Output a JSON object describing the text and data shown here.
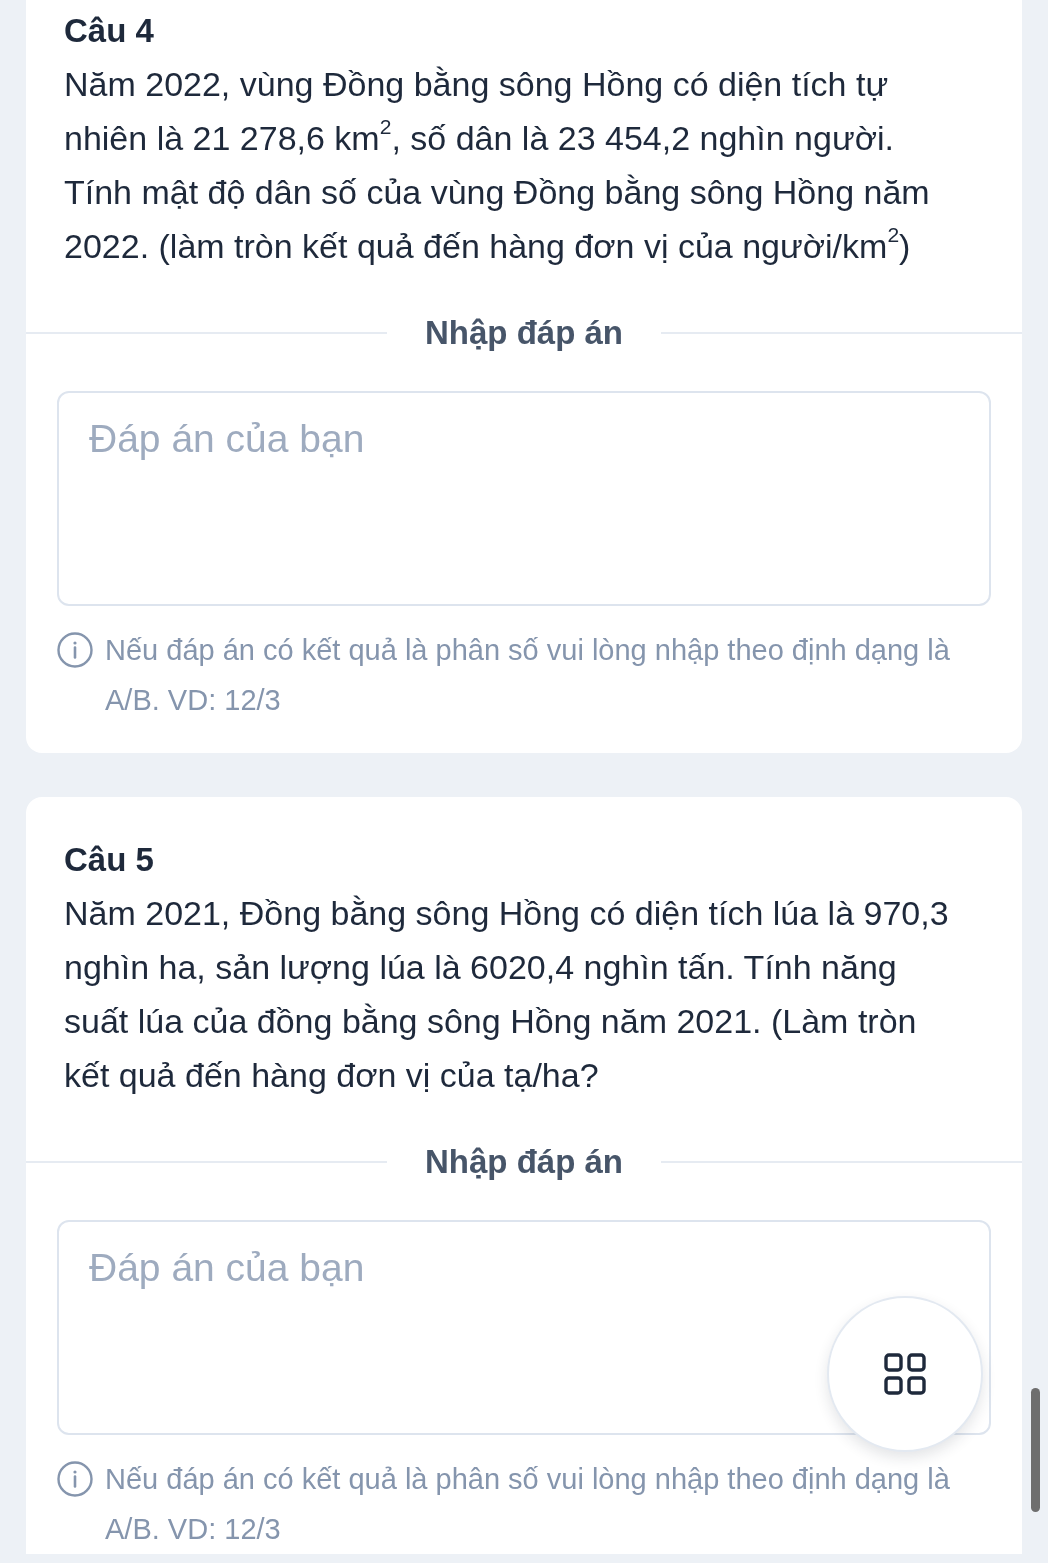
{
  "questions": [
    {
      "title": "Câu 4",
      "text": "Năm 2022, vùng Đồng bằng sông Hồng có diện tích tự nhiên là 21 278,6 km$^{2}$, số dân là 23 454,2 nghìn người. Tính mật độ dân số của vùng Đồng bằng sông Hồng năm 2022. (làm tròn kết quả đến hàng đơn vị của người/km$^{2}$)",
      "answer_heading": "Nhập đáp án",
      "answer_field": {
        "placeholder": "Đáp án của bạn"
      },
      "hint": "Nếu đáp án có kết quả là phân số vui lòng nhập theo định dạng là A/B. VD: 12/3"
    },
    {
      "title": "Câu 5",
      "text": "Năm 2021, Đồng bằng sông Hồng có diện tích lúa là 970,3 nghìn ha, sản lượng lúa là 6020,4 nghìn tấn. Tính năng suất lúa của đồng bằng sông Hồng năm 2021. (Làm tròn kết quả đến hàng đơn vị của tạ/ha?",
      "answer_heading": "Nhập đáp án",
      "answer_field": {
        "placeholder": "Đáp án của bạn"
      },
      "hint": "Nếu đáp án có kết quả là phân số vui lòng nhập theo định dạng là A/B. VD: 12/3"
    }
  ]
}
